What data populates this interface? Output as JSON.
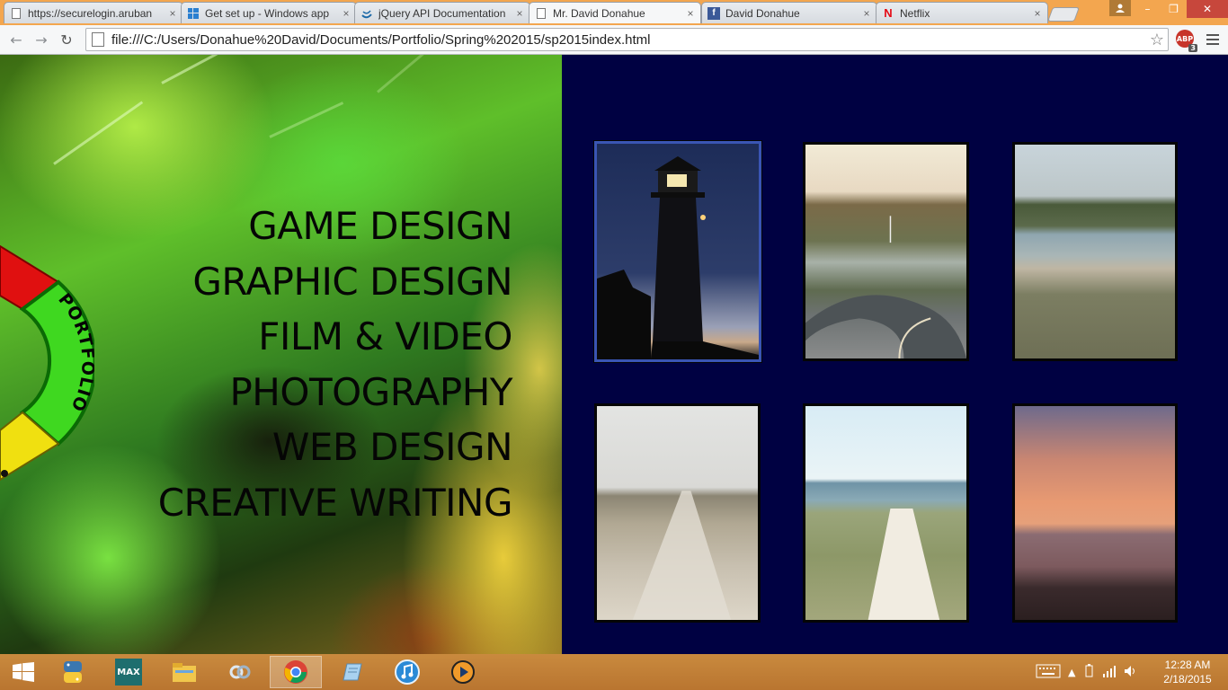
{
  "browser": {
    "tabs": [
      {
        "title": "https://securelogin.aruban",
        "favicon": "page-icon",
        "close": "×"
      },
      {
        "title": "Get set up - Windows app",
        "favicon": "windows-logo-icon",
        "close": "×"
      },
      {
        "title": "jQuery API Documentation",
        "favicon": "jquery-icon",
        "close": "×"
      },
      {
        "title": "Mr. David Donahue",
        "favicon": "page-icon",
        "close": "×"
      },
      {
        "title": "David Donahue",
        "favicon": "facebook-icon",
        "close": "×"
      },
      {
        "title": "Netflix",
        "favicon": "netflix-icon",
        "close": "×"
      }
    ],
    "address": "file:///C:/Users/Donahue%20David/Documents/Portfolio/Spring%202015/sp2015index.html",
    "abp_label": "ABP",
    "abp_count": "3",
    "favicon_letters": {
      "facebook": "f",
      "netflix": "N"
    }
  },
  "portfolio": {
    "wheel_label": "PORTFOLIO",
    "nav": [
      "GAME DESIGN",
      "GRAPHIC DESIGN",
      "FILM & VIDEO",
      "PHOTOGRAPHY",
      "WEB DESIGN",
      "CREATIVE WRITING"
    ],
    "background_color": "#000142",
    "photo_subjects": [
      "lighthouse-night",
      "coastal-road",
      "beach-cove",
      "dune-path-overcast",
      "dune-path-ocean",
      "sunset-shore"
    ],
    "selected_photo": 0
  },
  "taskbar": {
    "apps": [
      "python-icon",
      "3ds-max-icon",
      "file-explorer-icon",
      "network-icon",
      "chrome-icon",
      "notepad-icon",
      "itunes-icon",
      "media-player-icon"
    ],
    "active_app": "chrome-icon",
    "time": "12:28 AM",
    "date": "2/18/2015"
  }
}
